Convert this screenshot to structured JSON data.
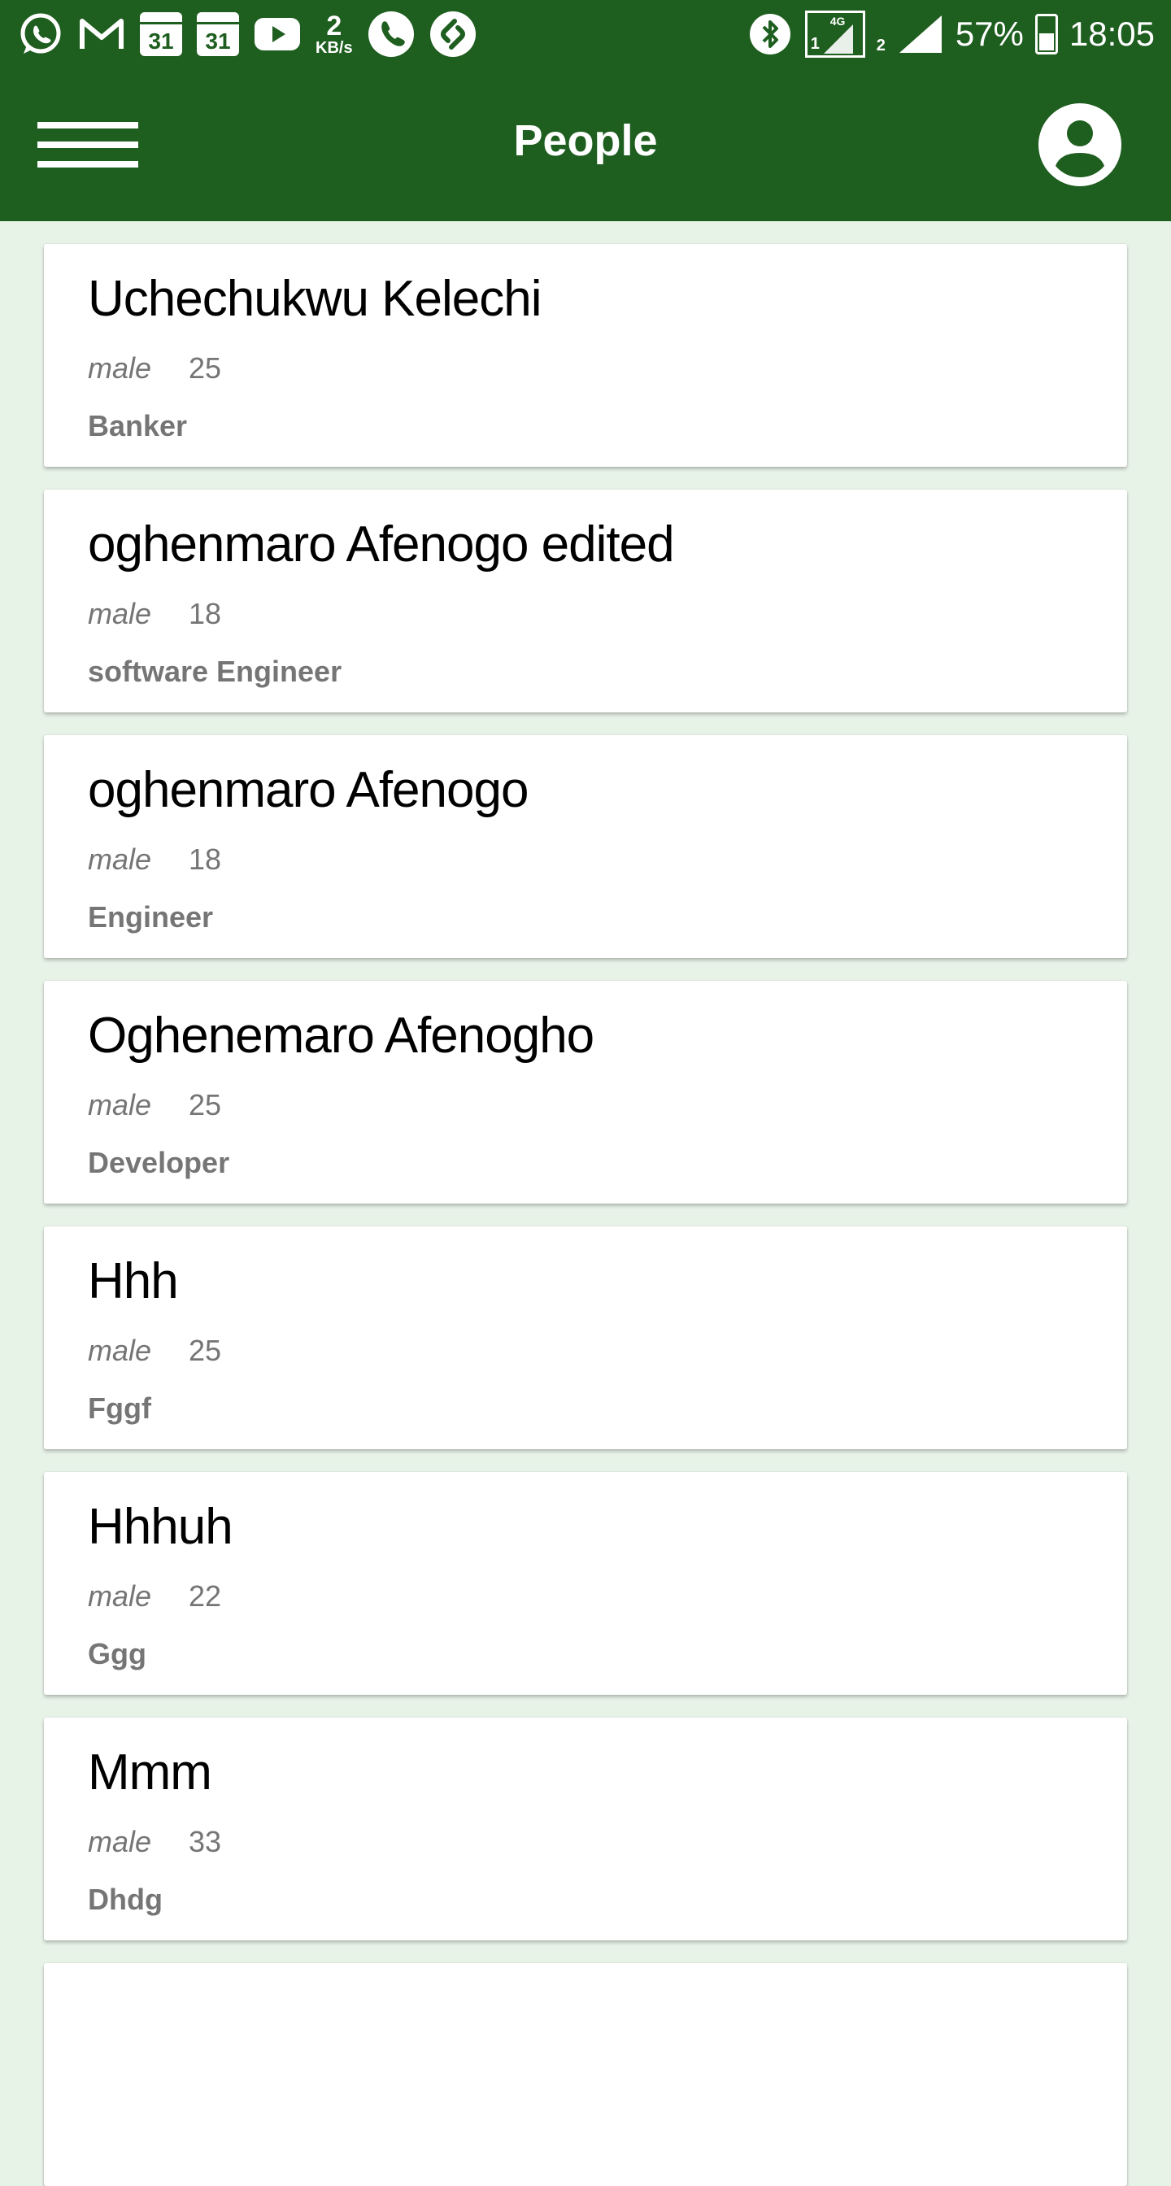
{
  "status_bar": {
    "left_icons": [
      "whatsapp-icon",
      "gmail-icon",
      "calendar-icon",
      "calendar-icon",
      "youtube-icon",
      "network-speed",
      "phone-icon",
      "shazam-icon"
    ],
    "calendar_day": "31",
    "network_speed_value": "2",
    "network_speed_unit": "KB/s",
    "network_type": "4G",
    "sim1_label": "1",
    "sim2_label": "2",
    "battery_percent": "57%",
    "battery_level": 0.57,
    "time": "18:05"
  },
  "app_bar": {
    "title": "People",
    "menu_icon": "hamburger-menu-icon",
    "account_icon": "account-circle-icon",
    "background_color": "#1e5e1f"
  },
  "people": [
    {
      "name": "Uchechukwu Kelechi",
      "gender": "male",
      "age": "25",
      "occupation": "Banker"
    },
    {
      "name": "oghenmaro Afenogo edited",
      "gender": "male",
      "age": "18",
      "occupation": "software Engineer"
    },
    {
      "name": "oghenmaro Afenogo",
      "gender": "male",
      "age": "18",
      "occupation": "Engineer"
    },
    {
      "name": "Oghenemaro Afenogho",
      "gender": "male",
      "age": "25",
      "occupation": "Developer"
    },
    {
      "name": "Hhh",
      "gender": "male",
      "age": "25",
      "occupation": "Fggf"
    },
    {
      "name": "Hhhuh",
      "gender": "male",
      "age": "22",
      "occupation": "Ggg"
    },
    {
      "name": "Mmm",
      "gender": "male",
      "age": "33",
      "occupation": "Dhdg"
    }
  ]
}
